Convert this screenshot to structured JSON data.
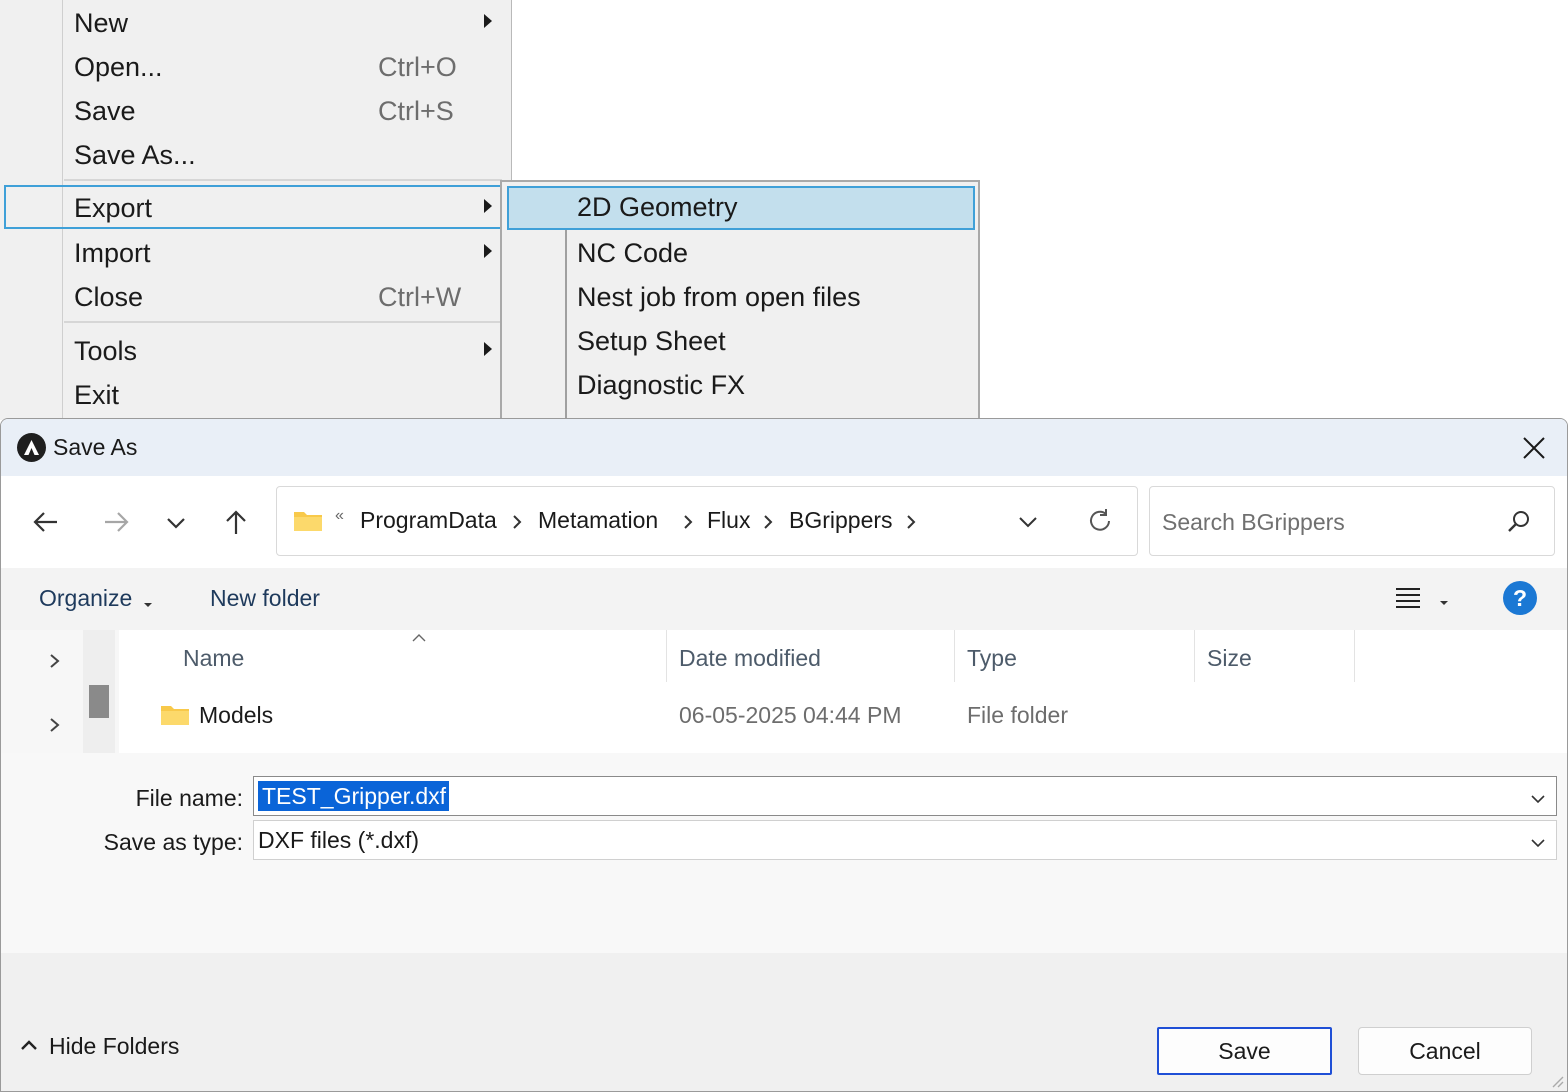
{
  "file_menu": {
    "items": [
      {
        "label": "New",
        "shortcut": "",
        "submenu": true
      },
      {
        "label": "Open...",
        "shortcut": "Ctrl+O",
        "submenu": false
      },
      {
        "label": "Save",
        "shortcut": "Ctrl+S",
        "submenu": false
      },
      {
        "label": "Save As...",
        "shortcut": "",
        "submenu": false
      },
      {
        "label": "Export",
        "shortcut": "",
        "submenu": true
      },
      {
        "label": "Import",
        "shortcut": "",
        "submenu": true
      },
      {
        "label": "Close",
        "shortcut": "Ctrl+W",
        "submenu": false
      },
      {
        "label": "Tools",
        "shortcut": "",
        "submenu": true
      },
      {
        "label": "Exit",
        "shortcut": "",
        "submenu": false
      }
    ]
  },
  "export_submenu": {
    "items": [
      "2D Geometry",
      "NC Code",
      "Nest job from open files",
      "Setup Sheet",
      "Diagnostic FX"
    ]
  },
  "dialog": {
    "title": "Save As",
    "breadcrumb": {
      "overflow": "«",
      "parts": [
        "ProgramData",
        "Metamation",
        "Flux",
        "BGrippers"
      ]
    },
    "search_placeholder": "Search BGrippers",
    "toolbar": {
      "organize": "Organize",
      "new_folder": "New folder",
      "help": "?"
    },
    "columns": [
      "Name",
      "Date modified",
      "Type",
      "Size"
    ],
    "rows": [
      {
        "name": "Models",
        "date_modified": "06-05-2025 04:44 PM",
        "type": "File folder",
        "size": ""
      }
    ],
    "file_name_label": "File name:",
    "file_name_value": "TEST_Gripper.dxf",
    "save_type_label": "Save as type:",
    "save_type_value": "DXF files (*.dxf)",
    "hide_folders": "Hide Folders",
    "save_button": "Save",
    "cancel_button": "Cancel"
  },
  "colors": {
    "menu_highlight_border": "#3fa0d8",
    "submenu_highlight_fill": "#c3dfed",
    "selection_blue": "#0a64d8",
    "primary_button_border": "#1f4fd6",
    "help_blue": "#1b78d4",
    "folder_yellow": "#f8c94a"
  }
}
